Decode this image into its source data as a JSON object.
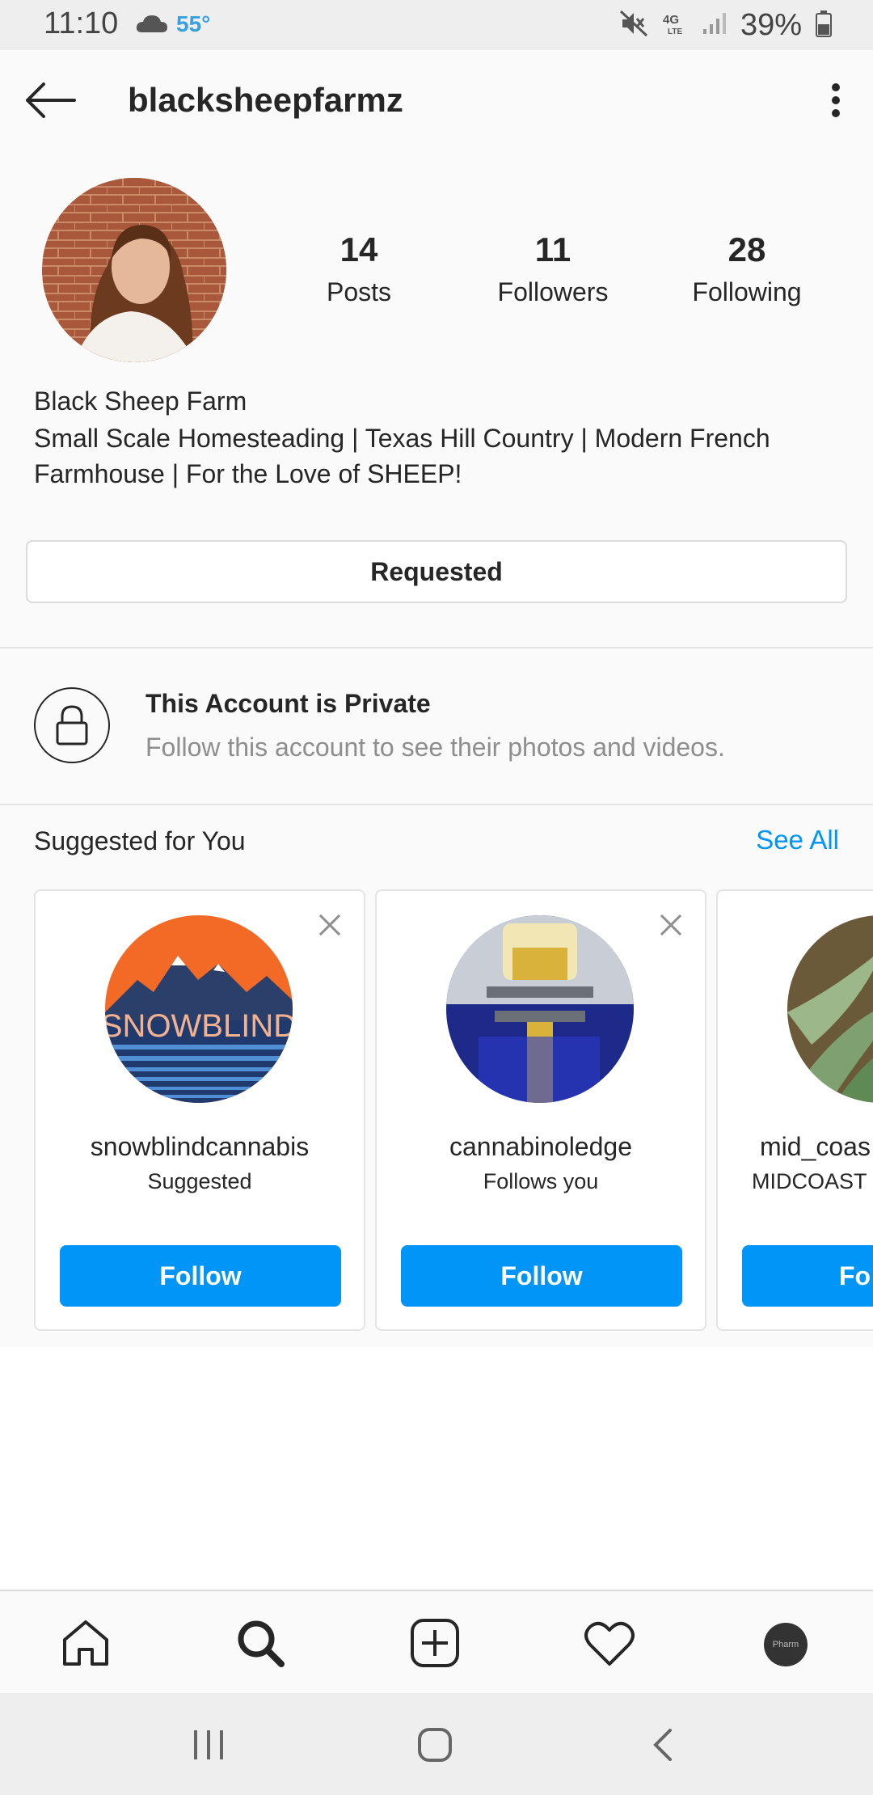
{
  "status_bar": {
    "time": "11:10",
    "temperature": "55°",
    "battery": "39%",
    "icons": [
      "weather-cloud-icon",
      "mute-icon",
      "4g-lte-icon",
      "signal-icon",
      "battery-icon"
    ]
  },
  "header": {
    "username": "blacksheepfarmz",
    "back_icon": "back-arrow-icon",
    "menu_icon": "more-vertical-icon"
  },
  "profile": {
    "stats": [
      {
        "value": "14",
        "label": "Posts"
      },
      {
        "value": "11",
        "label": "Followers"
      },
      {
        "value": "28",
        "label": "Following"
      }
    ],
    "name": "Black Sheep Farm",
    "bio": "Small Scale Homesteading | Texas Hill Country | Modern French Farmhouse | For the Love of SHEEP!",
    "action_button": "Requested"
  },
  "private_notice": {
    "title": "This Account is Private",
    "subtitle": "Follow this account to see their photos and videos."
  },
  "suggested": {
    "title": "Suggested for You",
    "see_all": "See All",
    "cards": [
      {
        "username": "snowblindcannabis",
        "subtitle": "Suggested",
        "button": "Follow",
        "avatar_text": "SNOWBLIND"
      },
      {
        "username": "cannabinoledge",
        "subtitle": "Follows you",
        "button": "Follow"
      },
      {
        "username": "mid_coas",
        "subtitle": "MIDCOAST (",
        "button": "Fo"
      }
    ]
  },
  "bottom_nav": {
    "items": [
      "home-icon",
      "search-icon",
      "new-post-icon",
      "activity-heart-icon",
      "profile-avatar-icon"
    ],
    "avatar_text": "Pharm"
  },
  "system_nav": [
    "recents-icon",
    "home-button-icon",
    "back-icon"
  ],
  "colors": {
    "accent": "#0095f6",
    "text": "#262626",
    "muted": "#8e8e8e",
    "background": "#fafafa",
    "border": "#dbdbdb"
  }
}
